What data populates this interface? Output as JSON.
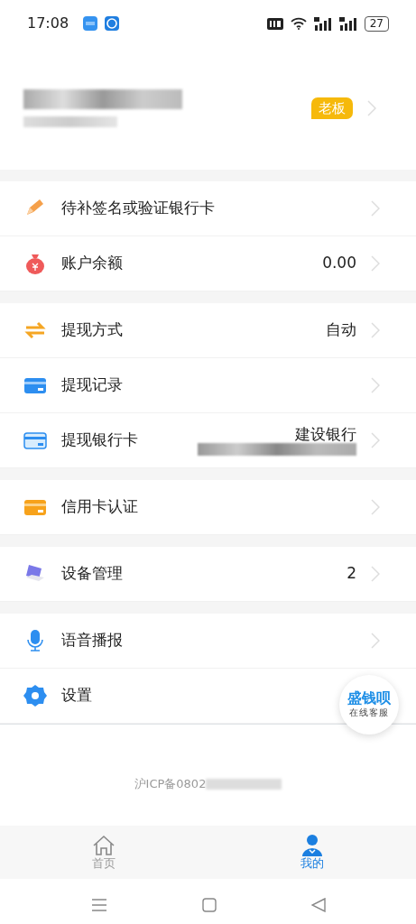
{
  "status_bar": {
    "time": "17:08",
    "battery": "27"
  },
  "profile": {
    "badge": "老板"
  },
  "sections": [
    {
      "rows": [
        {
          "label": "待补签名或验证银行卡"
        },
        {
          "label": "账户余额",
          "value": "0.00"
        }
      ]
    },
    {
      "rows": [
        {
          "label": "提现方式",
          "value": "自动"
        },
        {
          "label": "提现记录"
        },
        {
          "label": "提现银行卡",
          "value": "建设银行"
        }
      ]
    },
    {
      "rows": [
        {
          "label": "信用卡认证"
        }
      ]
    },
    {
      "rows": [
        {
          "label": "设备管理",
          "value": "2"
        }
      ]
    },
    {
      "rows": [
        {
          "label": "语音播报"
        },
        {
          "label": "设置",
          "chevron": false
        }
      ]
    }
  ],
  "support_button": {
    "title": "盛钱呗",
    "subtitle": "在线客服"
  },
  "footer": {
    "icp": "沪ICP备0802"
  },
  "tab_bar": [
    {
      "label": "首页",
      "selected": false
    },
    {
      "label": "我的",
      "selected": true
    }
  ]
}
